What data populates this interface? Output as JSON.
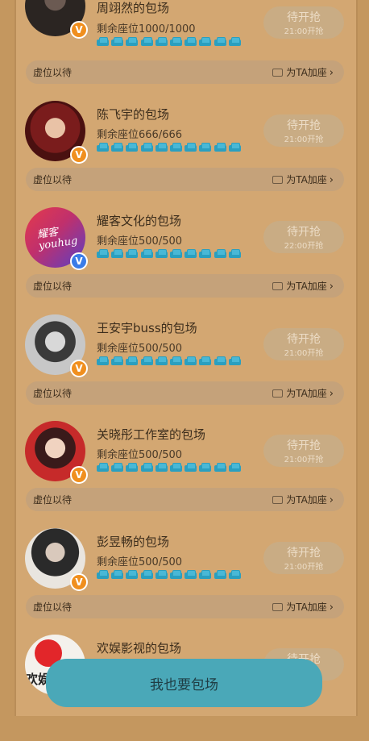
{
  "cards": [
    {
      "title": "周翊然的包场",
      "seats": "剩余座位1000/1000",
      "grab_main": "待开抢",
      "grab_time": "21:00开抢",
      "hold": "虚位以待",
      "add": "为TA加座",
      "badge": "V",
      "badge_color": "#f08f1e"
    },
    {
      "title": "陈飞宇的包场",
      "seats": "剩余座位666/666",
      "grab_main": "待开抢",
      "grab_time": "21:00开抢",
      "hold": "虚位以待",
      "add": "为TA加座",
      "badge": "V",
      "badge_color": "#f08f1e"
    },
    {
      "title": "耀客文化的包场",
      "seats": "剩余座位500/500",
      "grab_main": "待开抢",
      "grab_time": "22:00开抢",
      "hold": "虚位以待",
      "add": "为TA加座",
      "badge": "V",
      "badge_color": "#3a7ce8",
      "avatar_text": "耀客 youhug"
    },
    {
      "title": "王安宇buss的包场",
      "seats": "剩余座位500/500",
      "grab_main": "待开抢",
      "grab_time": "21:00开抢",
      "hold": "虚位以待",
      "add": "为TA加座",
      "badge": "V",
      "badge_color": "#f08f1e"
    },
    {
      "title": "关晓彤工作室的包场",
      "seats": "剩余座位500/500",
      "grab_main": "待开抢",
      "grab_time": "21:00开抢",
      "hold": "虚位以待",
      "add": "为TA加座",
      "badge": "V",
      "badge_color": "#f08f1e"
    },
    {
      "title": "彭昱畅的包场",
      "seats": "剩余座位500/500",
      "grab_main": "待开抢",
      "grab_time": "21:00开抢",
      "hold": "虚位以待",
      "add": "为TA加座",
      "badge": "V",
      "badge_color": "#f08f1e"
    },
    {
      "title": "欢娱影视的包场",
      "grab_main": "待开抢",
      "avatar_text": "欢娱"
    }
  ],
  "cta_label": "我也要包场",
  "seat_icon": "seat-icon",
  "colors": {
    "background": "#c4975f",
    "panel": "#d3a772",
    "seat": "#2b9fbf",
    "cta": "#4aa8b8"
  }
}
